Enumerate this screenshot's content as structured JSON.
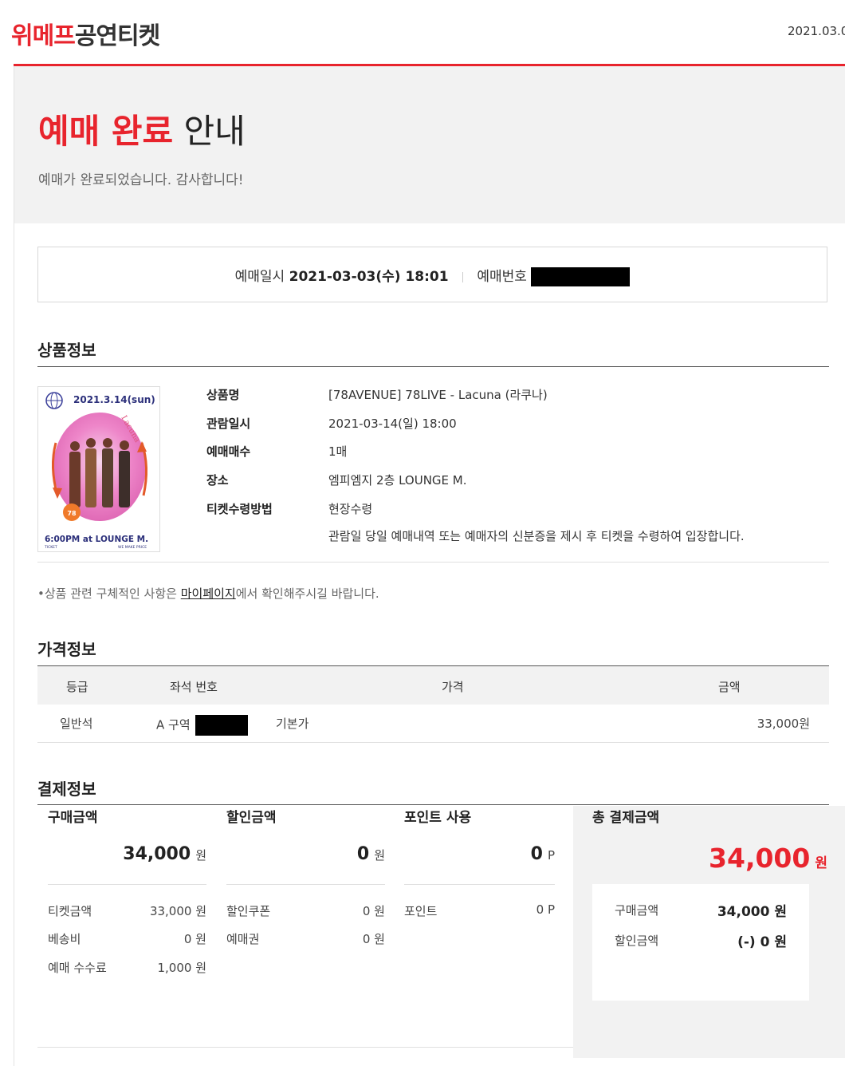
{
  "header": {
    "logo_red": "위메프",
    "logo_dark": "공연티켓",
    "date": "2021.03.0"
  },
  "hero": {
    "title_red": "예매 완료",
    "title_dark": "안내",
    "subtitle": "예매가 완료되었습니다. 감사합니다!"
  },
  "reservation": {
    "datetime_label": "예매일시",
    "datetime_value": "2021-03-03(수) 18:01",
    "number_label": "예매번호"
  },
  "product": {
    "section_title": "상품정보",
    "poster": {
      "date": "2021.3.14(sun)",
      "script": "Lacuna",
      "badge": "78",
      "footer": "6:00PM at LOUNGE M.",
      "small_left": "TICKET",
      "small_right": "WE MAKE PRICE"
    },
    "rows": [
      {
        "label": "상품명",
        "value": "[78AVENUE] 78LIVE - Lacuna (라쿠나)"
      },
      {
        "label": "관람일시",
        "value": "2021-03-14(일) 18:00"
      },
      {
        "label": "예매매수",
        "value": "1매"
      },
      {
        "label": "장소",
        "value": "엠피엠지 2층 LOUNGE M."
      },
      {
        "label": "티켓수령방법",
        "value": "현장수령"
      }
    ],
    "pickup_note": "관람일 당일 예매내역 또는 예매자의 신분증을 제시 후 티켓을 수령하여 입장합니다.",
    "notice_prefix": "•상품 관련 구체적인 사항은 ",
    "notice_link": "마이페이지",
    "notice_suffix": "에서 확인해주시길 바랍니다."
  },
  "price": {
    "section_title": "가격정보",
    "headers": [
      "등급",
      "좌석 번호",
      "가격",
      "금액"
    ],
    "row": {
      "grade": "일반석",
      "seat": "A 구역",
      "price_type": "기본가",
      "amount": "33,000원"
    }
  },
  "payment": {
    "section_title": "결제정보",
    "purchase": {
      "title": "구매금액",
      "amount": "34,000",
      "unit": "원",
      "items": [
        {
          "label": "티켓금액",
          "value": "33,000 원"
        },
        {
          "label": "베송비",
          "value": "0 원"
        },
        {
          "label": "예매 수수료",
          "value": "1,000 원"
        }
      ]
    },
    "discount": {
      "title": "할인금액",
      "amount": "0",
      "unit": "원",
      "items": [
        {
          "label": "할인쿠폰",
          "value": "0 원"
        },
        {
          "label": "예매권",
          "value": "0 원"
        }
      ]
    },
    "points": {
      "title": "포인트 사용",
      "amount": "0",
      "unit": "P",
      "items": [
        {
          "label": "포인트",
          "value": "0 P"
        }
      ]
    },
    "total": {
      "title": "총 결제금액",
      "amount": "34,000",
      "unit": "원",
      "items": [
        {
          "label": "구매금액",
          "value": "34,000 원"
        },
        {
          "label": "할인금액",
          "value": "(-) 0 원"
        }
      ]
    }
  },
  "colors": {
    "accent": "#e8242d",
    "panel": "#f2f2f2"
  }
}
